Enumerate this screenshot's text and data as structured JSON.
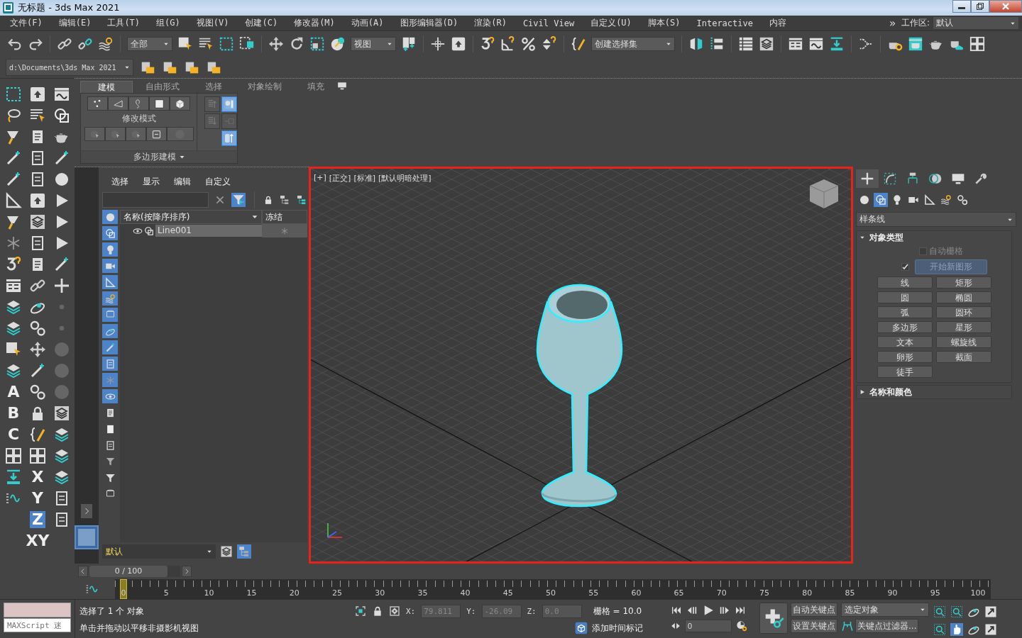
{
  "window": {
    "title": "无标题 - 3ds Max 2021"
  },
  "menu": {
    "items": [
      "文件(F)",
      "编辑(E)",
      "工具(T)",
      "组(G)",
      "视图(V)",
      "创建(C)",
      "修改器(M)",
      "动画(A)",
      "图形编辑器(D)",
      "渲染(R)",
      "Civil View",
      "自定义(U)",
      "脚本(S)",
      "Interactive",
      "内容"
    ],
    "overflow": "»",
    "workspace_label": "工作区:",
    "workspace": "默认"
  },
  "toolbar": {
    "selection_filter": "全部",
    "reference_coord": "视图",
    "named_selection": "创建选择集",
    "project_path": "d:\\Documents\\3ds Max 2021"
  },
  "ribbon": {
    "tabs": [
      {
        "label": "建模",
        "selected": true
      },
      {
        "label": "自由形式",
        "selected": false
      },
      {
        "label": "选择",
        "selected": false
      },
      {
        "label": "对象绘制",
        "selected": false
      },
      {
        "label": "填充",
        "selected": false
      }
    ],
    "panel_label": "修改模式",
    "panel_title": "多边形建模"
  },
  "left_toolbar": {
    "letters": [
      "A",
      "B",
      "C"
    ],
    "axis_constraints": [
      {
        "label": "X",
        "selected": false
      },
      {
        "label": "Y",
        "selected": false
      },
      {
        "label": "Z",
        "selected": true
      },
      {
        "label": "XY",
        "selected": false
      }
    ]
  },
  "scene_explorer": {
    "menu": [
      "选择",
      "显示",
      "编辑",
      "自定义"
    ],
    "filters": [
      {
        "on": true
      },
      {
        "on": true
      },
      {
        "on": true
      },
      {
        "on": true
      },
      {
        "on": true
      },
      {
        "on": true
      },
      {
        "on": true
      },
      {
        "on": true
      },
      {
        "on": true
      },
      {
        "on": true
      },
      {
        "on": true
      },
      {
        "on": true
      },
      {
        "on": false
      },
      {
        "on": false
      },
      {
        "on": false
      },
      {
        "on": false
      },
      {
        "on": false
      },
      {
        "on": false
      }
    ],
    "columns": [
      "名称(按降序排序)",
      "冻结"
    ],
    "rows": [
      {
        "name": "Line001",
        "selected": true,
        "frozen": false
      }
    ],
    "layer": "默认"
  },
  "viewport": {
    "labels": [
      "[+]",
      "[正交]",
      "[标准]",
      "[默认明暗处理]"
    ],
    "active": true
  },
  "command_panel": {
    "tabs": [
      {
        "selected": true
      },
      {
        "selected": false
      },
      {
        "selected": false
      },
      {
        "selected": false
      },
      {
        "selected": false
      },
      {
        "selected": false
      }
    ],
    "categories": [
      {
        "selected": false
      },
      {
        "selected": true
      },
      {
        "selected": false
      },
      {
        "selected": false
      },
      {
        "selected": false
      },
      {
        "selected": false
      },
      {
        "selected": false
      }
    ],
    "category": "样条线",
    "rollouts": [
      {
        "title": "对象类型",
        "expanded": true,
        "auto_grid": {
          "label": "自动栅格",
          "checked": false
        },
        "start_new_shape": {
          "label": "开始新图形",
          "checked": true
        },
        "buttons": [
          "线",
          "矩形",
          "圆",
          "椭圆",
          "弧",
          "圆环",
          "多边形",
          "星形",
          "文本",
          "螺旋线",
          "卵形",
          "截面",
          "徒手"
        ]
      },
      {
        "title": "名称和颜色",
        "expanded": false
      }
    ]
  },
  "timeline": {
    "slider": {
      "label": "0 / 100"
    },
    "ticks": [
      "0",
      "5",
      "10",
      "15",
      "20",
      "25",
      "30",
      "35",
      "40",
      "45",
      "50",
      "55",
      "60",
      "65",
      "70",
      "75",
      "80",
      "85",
      "90",
      "95",
      "100"
    ]
  },
  "status_bar": {
    "listener": {
      "placeholder": "MAXScript 迷"
    },
    "selection": "选择了 1 个 对象",
    "prompt": "单击并拖动以平移非摄影机视图",
    "coords": [
      {
        "label": "X:",
        "value": "79.811"
      },
      {
        "label": "Y:",
        "value": "-26.09"
      },
      {
        "label": "Z:",
        "value": "0.0"
      }
    ],
    "grid": "栅格 = 10.0",
    "time_tag": "添加时间标记",
    "frame": "0",
    "auto_key": "自动关键点",
    "set_key": "设置关键点",
    "key_mode": "选定对象",
    "key_filters": "关键点过滤器..."
  }
}
